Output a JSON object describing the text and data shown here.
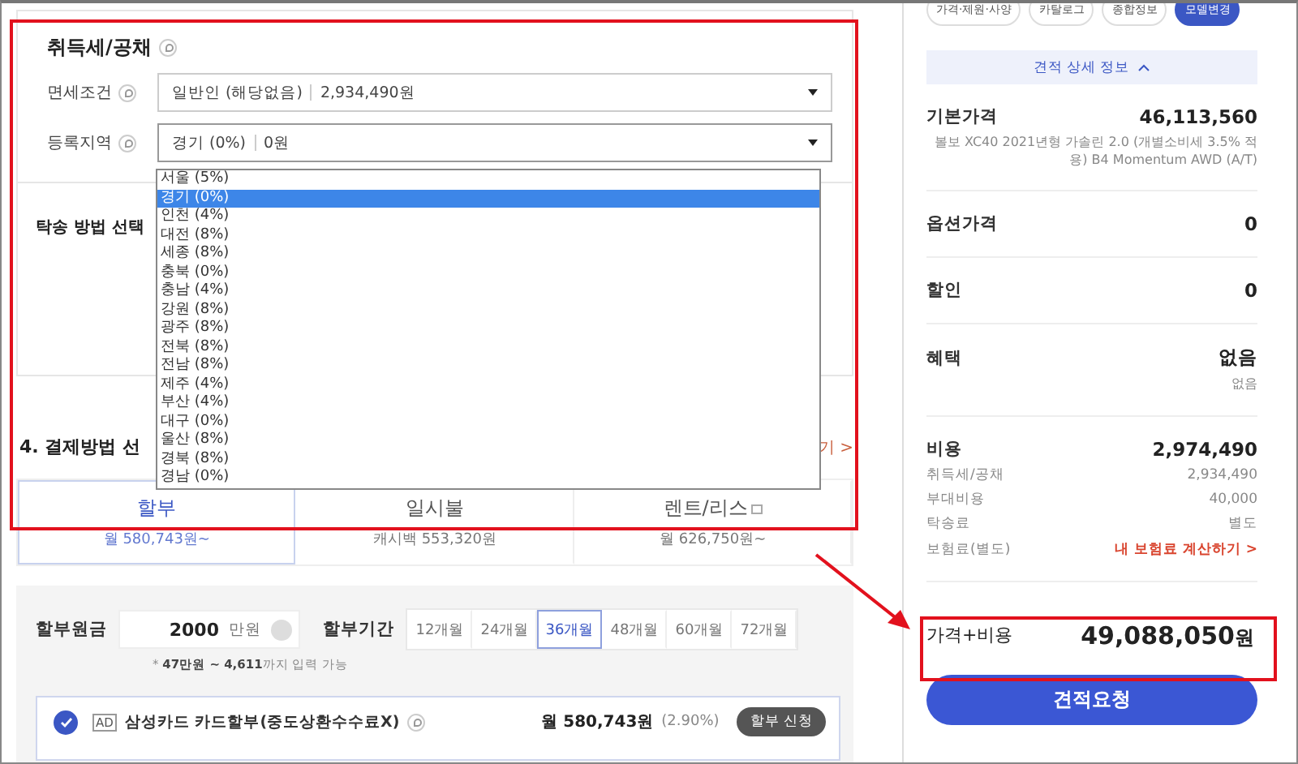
{
  "tax_section": {
    "title": "취득세/공채",
    "fields": [
      {
        "label": "면세조건",
        "value": "일반인 (해당없음)",
        "amount": "2,934,490원",
        "expanded": false
      },
      {
        "label": "등록지역",
        "value": "경기 (0%)",
        "amount": "0원",
        "expanded": true
      }
    ]
  },
  "region_options": [
    {
      "label": "서울 (5%)",
      "selected": false
    },
    {
      "label": "경기 (0%)",
      "selected": true
    },
    {
      "label": "인천 (4%)",
      "selected": false
    },
    {
      "label": "대전 (8%)",
      "selected": false
    },
    {
      "label": "세종 (8%)",
      "selected": false
    },
    {
      "label": "충북 (0%)",
      "selected": false
    },
    {
      "label": "충남 (4%)",
      "selected": false
    },
    {
      "label": "강원 (8%)",
      "selected": false
    },
    {
      "label": "광주 (8%)",
      "selected": false
    },
    {
      "label": "전북 (8%)",
      "selected": false
    },
    {
      "label": "전남 (8%)",
      "selected": false
    },
    {
      "label": "제주 (4%)",
      "selected": false
    },
    {
      "label": "부산 (4%)",
      "selected": false
    },
    {
      "label": "대구 (0%)",
      "selected": false
    },
    {
      "label": "울산 (8%)",
      "selected": false
    },
    {
      "label": "경북 (8%)",
      "selected": false
    },
    {
      "label": "경남 (0%)",
      "selected": false
    }
  ],
  "delivery_section": {
    "title": "탁송 방법 선택"
  },
  "payment_section": {
    "title": "4. 결제방법 선",
    "link": "기 >",
    "methods": [
      {
        "name": "할부",
        "detail": "월 580,743원~",
        "selected": true,
        "external": false
      },
      {
        "name": "일시불",
        "detail": "캐시백 553,320원",
        "selected": false,
        "external": false
      },
      {
        "name": "렌트/리스",
        "detail": "월 626,750원~",
        "selected": false,
        "external": true
      }
    ]
  },
  "installment": {
    "principal_label": "할부원금",
    "principal_value": "2000",
    "unit": "만원",
    "hint": "* **47만원 ~ 4,611**까지 입력 가능",
    "period_label": "할부기간",
    "periods": [
      {
        "label": "12개월",
        "selected": false
      },
      {
        "label": "24개월",
        "selected": false
      },
      {
        "label": "36개월",
        "selected": true
      },
      {
        "label": "48개월",
        "selected": false
      },
      {
        "label": "60개월",
        "selected": false
      },
      {
        "label": "72개월",
        "selected": false
      }
    ]
  },
  "card_offer": {
    "checked": true,
    "badge": "AD",
    "name": "삼성카드 카드할부(중도상환수수료X)",
    "monthly": "월 580,743원",
    "rate": "(2.90%)",
    "button": "할부 신청"
  },
  "side_panel": {
    "tabs": [
      {
        "label": "가격·제원·사양",
        "selected": false
      },
      {
        "label": "카탈로그",
        "selected": false
      },
      {
        "label": "종합정보",
        "selected": false
      },
      {
        "label": "모델변경",
        "selected": true
      }
    ],
    "detail_toggle": {
      "label": "견적 상세 정보",
      "expanded": true
    },
    "rows": [
      {
        "label": "기본가격",
        "value": "46,113,560",
        "note": "볼보 XC40 2021년형 가솔린 2.0 (개별소비세 3.5% 적용) B4 Momentum AWD (A/T)"
      },
      {
        "label": "옵션가격",
        "value": "0"
      },
      {
        "label": "할인",
        "value": "0"
      },
      {
        "label": "혜택",
        "value": "없음",
        "note": "없음"
      },
      {
        "label": "비용",
        "value": "2,974,490",
        "items": [
          {
            "label": "취득세/공채",
            "value": "2,934,490",
            "kind": "plain"
          },
          {
            "label": "부대비용",
            "value": "40,000",
            "kind": "plain"
          },
          {
            "label": "탁송료",
            "value": "별도",
            "kind": "plain"
          },
          {
            "label": "보험료(별도)",
            "value": "내 보험료 계산하기 >",
            "kind": "link"
          }
        ]
      }
    ],
    "total": {
      "label": "가격+비용",
      "value": "49,088,050",
      "unit": "원"
    },
    "button": "견적요청"
  }
}
